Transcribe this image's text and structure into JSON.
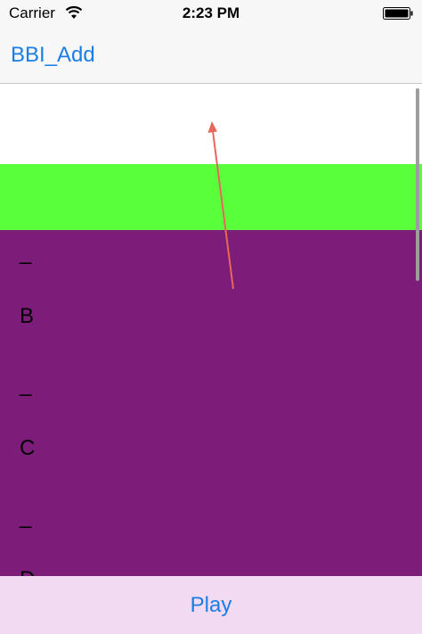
{
  "status_bar": {
    "carrier": "Carrier",
    "time": "2:23 PM",
    "wifi_icon": "wifi-icon",
    "battery_icon": "battery-icon"
  },
  "nav": {
    "title": "BBI_Add"
  },
  "content": {
    "colors": {
      "green": "#5aff3c",
      "purple": "#7d1d7a",
      "arrow": "#e8665b"
    },
    "rows": [
      {
        "label": "_"
      },
      {
        "label": "B"
      },
      {
        "label": "_"
      },
      {
        "label": "C"
      },
      {
        "label": "_"
      },
      {
        "label": "D"
      }
    ]
  },
  "toolbar": {
    "play_label": "Play"
  }
}
